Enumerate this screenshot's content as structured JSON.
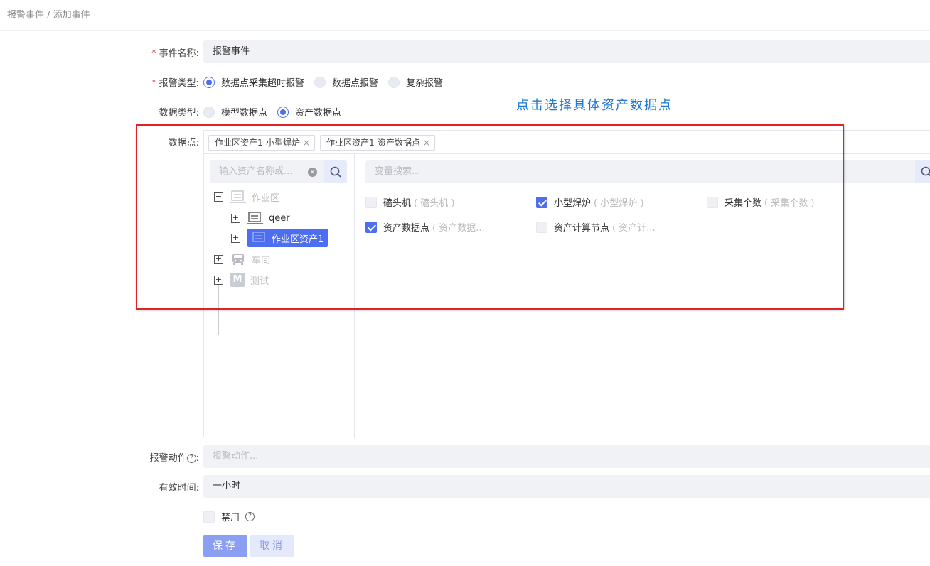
{
  "breadcrumb": "报警事件 / 添加事件",
  "form": {
    "event_name_label": "事件名称:",
    "event_name_value": "报警事件",
    "alarm_type_label": "报警类型:",
    "alarm_types": [
      "数据点采集超时报警",
      "数据点报警",
      "复杂报警"
    ],
    "alarm_type_selected": "数据点采集超时报警",
    "data_type_label": "数据类型:",
    "data_types": [
      "模型数据点",
      "资产数据点"
    ],
    "data_type_selected": "资产数据点",
    "data_point_label": "数据点:",
    "selected_tags": [
      "作业区资产1-小型焊炉",
      "作业区资产1-资产数据点"
    ],
    "tag_close": "×",
    "asset_search_placeholder": "输入资产名称或...",
    "tree": [
      {
        "label": "作业区",
        "expanded": true
      },
      {
        "label": "qeer"
      },
      {
        "label": "作业区资产1",
        "selected": true
      },
      {
        "label": "车间"
      },
      {
        "label": "测试",
        "icon_text": "M"
      }
    ],
    "tree_toggle_minus": "−",
    "tree_toggle_plus": "+",
    "variable_search_placeholder": "变量搜索...",
    "variables": [
      {
        "name": "磕头机",
        "sub": "( 磕头机 )",
        "checked": false
      },
      {
        "name": "小型焊炉",
        "sub": "( 小型焊炉 )",
        "checked": true
      },
      {
        "name": "采集个数",
        "sub": "( 采集个数 )",
        "checked": false
      },
      {
        "name": "资产数据点",
        "sub": "( 资产数据...",
        "checked": true
      },
      {
        "name": "资产计算节点",
        "sub": "( 资产计...",
        "checked": false
      }
    ],
    "alarm_action_label": "报警动作",
    "alarm_action_placeholder": "报警动作...",
    "valid_time_label": "有效时间:",
    "valid_time_value": "一小时",
    "disable_label": "禁用",
    "help_mark": "?",
    "save_label": "保存",
    "cancel_label": "取消"
  },
  "annotation": "点击选择具体资产数据点",
  "colors": {
    "accent": "#4e6ef2",
    "annotation": "#1f78d1",
    "highlight_box": "#dd2424"
  }
}
